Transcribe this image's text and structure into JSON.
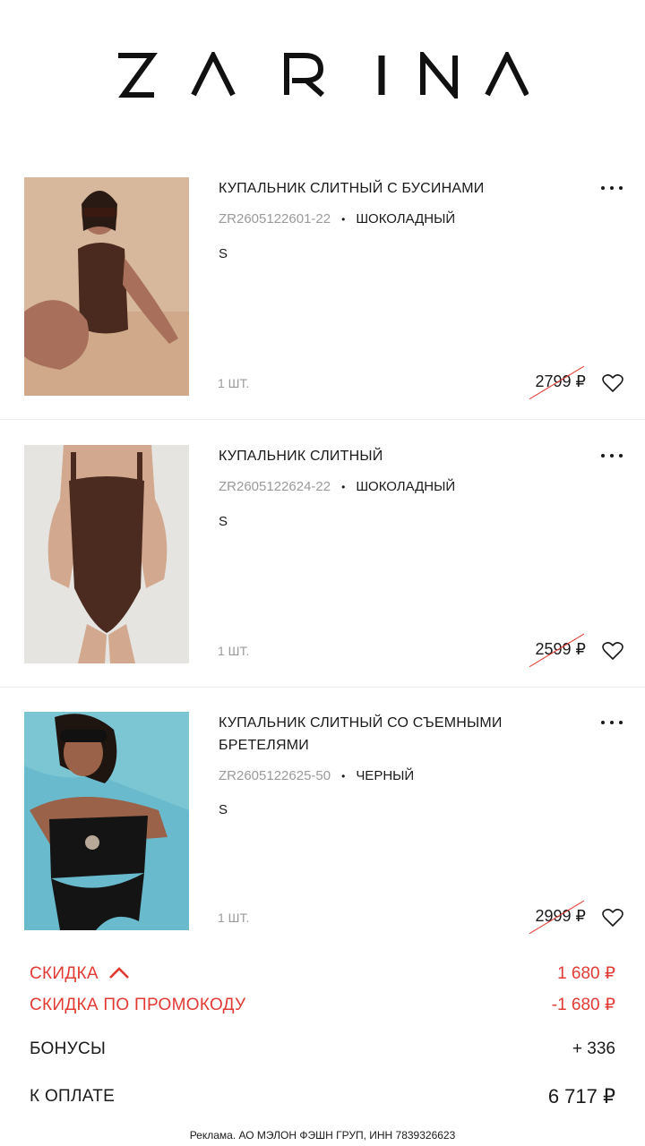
{
  "brand": {
    "name": "ZARINA"
  },
  "items": [
    {
      "title": "КУПАЛЬНИК СЛИТНЫЙ С БУСИНАМИ",
      "sku": "ZR2605122601-22",
      "color": "ШОКОЛАДНЫЙ",
      "size": "S",
      "qty": "1 ШТ.",
      "price": "2799 ₽",
      "photo": {
        "bg": "#d8b89c",
        "suit": "#4a2a1e",
        "skin": "#a8705a"
      }
    },
    {
      "title": "КУПАЛЬНИК СЛИТНЫЙ",
      "sku": "ZR2605122624-22",
      "color": "ШОКОЛАДНЫЙ",
      "size": "S",
      "qty": "1 ШТ.",
      "price": "2599 ₽",
      "photo": {
        "bg": "#e6e4e0",
        "suit": "#4b2a20",
        "skin": "#d2a88e"
      }
    },
    {
      "title": "КУПАЛЬНИК СЛИТНЫЙ СО СЪЕМНЫМИ БРЕТЕЛЯМИ",
      "sku": "ZR2605122625-50",
      "color": "ЧЕРНЫЙ",
      "size": "S",
      "qty": "1 ШТ.",
      "price": "2999 ₽",
      "photo": {
        "bg": "#7cc6d4",
        "suit": "#141414",
        "skin": "#9a6248"
      }
    }
  ],
  "summary": {
    "discount_label": "СКИДКА",
    "discount_value": "1 680 ₽",
    "promo_label": "СКИДКА ПО ПРОМОКОДУ",
    "promo_value": "-1 680 ₽",
    "bonus_label": "БОНУСЫ",
    "bonus_value": "+ 336",
    "total_label": "К ОПЛАТЕ",
    "total_value": "6 717 ₽"
  },
  "ad_text": "Реклама. АО МЭЛОН ФЭШН ГРУП, ИНН 7839326623",
  "colors": {
    "accent": "#e23a33",
    "text": "#1a1a1a",
    "muted": "#9a9a9a"
  },
  "icons": [
    "more-icon",
    "heart-icon",
    "chevron-up-icon"
  ]
}
